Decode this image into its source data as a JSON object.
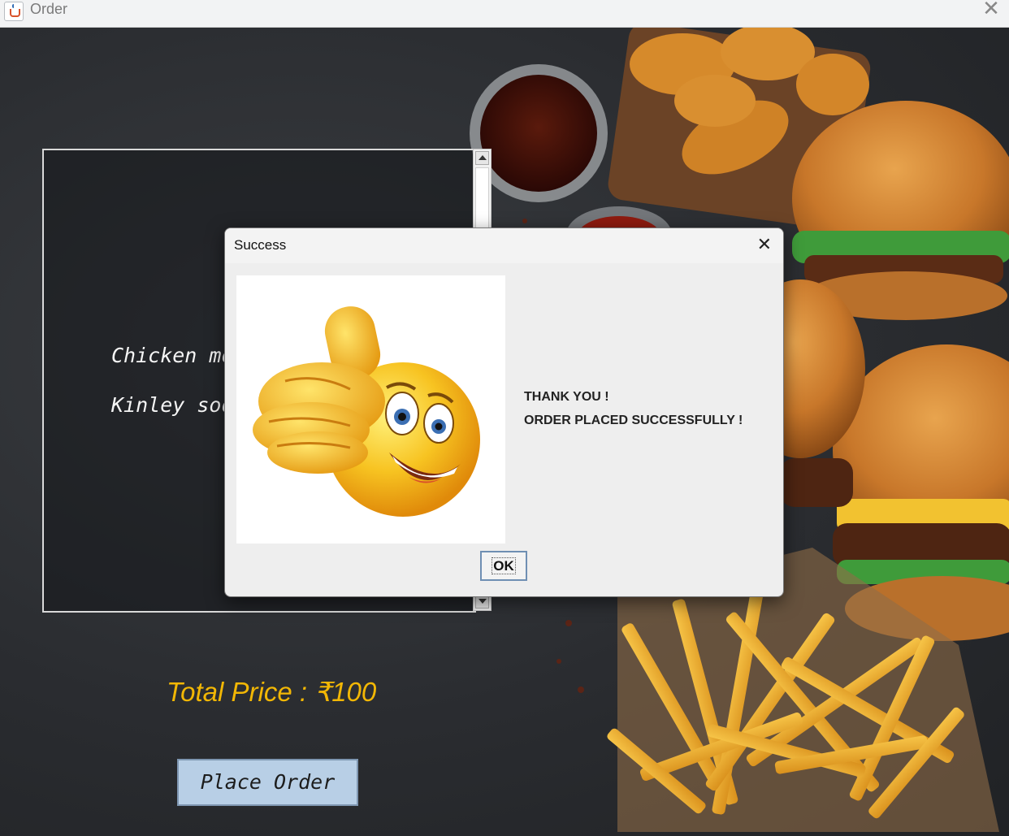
{
  "window": {
    "title": "Order",
    "close_glyph": "✕"
  },
  "order_list": {
    "items": [
      "Chicken mo",
      "Kinley soda"
    ]
  },
  "total": {
    "label": "Total Price : ₹100"
  },
  "place_order": {
    "label": "Place Order"
  },
  "dialog": {
    "title": "Success",
    "close_glyph": "✕",
    "message_line1": "THANK YOU !",
    "message_line2": "ORDER PLACED SUCCESSFULLY !",
    "ok_label": "OK",
    "image_icon": "thumbs-up-smiley-icon"
  },
  "colors": {
    "total_text": "#f2b705",
    "button_bg": "#b8cfe6"
  }
}
